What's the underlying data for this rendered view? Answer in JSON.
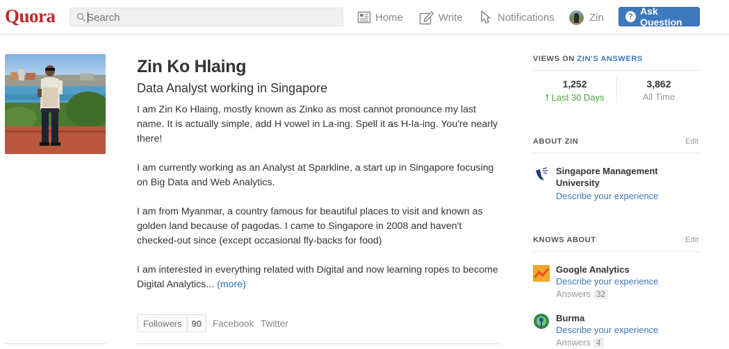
{
  "header": {
    "logo": "Quora",
    "search_placeholder": "Search",
    "nav": {
      "home": "Home",
      "write": "Write",
      "notifications": "Notifications",
      "user": "Zin"
    },
    "ask_button": "Ask Question",
    "brand_color": "#b92b27",
    "accent_color": "#3e78bd"
  },
  "profile": {
    "name": "Zin Ko Hlaing",
    "tagline": "Data Analyst working in Singapore",
    "bio": [
      "I am Zin Ko Hlaing, mostly known as Zinko as most cannot pronounce my last name. It is actually simple, add H vowel in La-ing. Spell it as H-la-ing. You're nearly there!",
      "I am currently working as an Analyst at Sparkline, a start up in Singapore focusing on Big Data and Web Analytics.",
      "I am from Myanmar, a country famous for beautiful places to visit and known as golden land because of pagodas. I came to Singapore in 2008 and haven't checked-out since (except occasional fly-backs for food)",
      "I am interested in everything related with Digital and now learning ropes to become Digital Analytics..."
    ],
    "more_link": "(more)",
    "followers_label": "Followers",
    "followers_count": "90",
    "facebook": "Facebook",
    "twitter": "Twitter"
  },
  "views": {
    "title_prefix": "VIEWS ON ",
    "title_highlight": "ZIN'S ANSWERS",
    "recent_count": "1,252",
    "recent_label": "Last 30 Days",
    "total_count": "3,862",
    "total_label": "All Time"
  },
  "about": {
    "title": "ABOUT ZIN",
    "edit": "Edit",
    "school": "Singapore Management University",
    "school_desc": "Describe your experience"
  },
  "knows_about": {
    "title": "KNOWS ABOUT",
    "edit": "Edit",
    "topics": [
      {
        "name": "Google Analytics",
        "desc": "Describe your experience",
        "answers_label": "Answers",
        "answers_count": "32",
        "icon": "google-analytics-icon"
      },
      {
        "name": "Burma",
        "desc": "Describe your experience",
        "answers_label": "Answers",
        "answers_count": "4",
        "icon": "burma-peacock-icon"
      }
    ]
  }
}
